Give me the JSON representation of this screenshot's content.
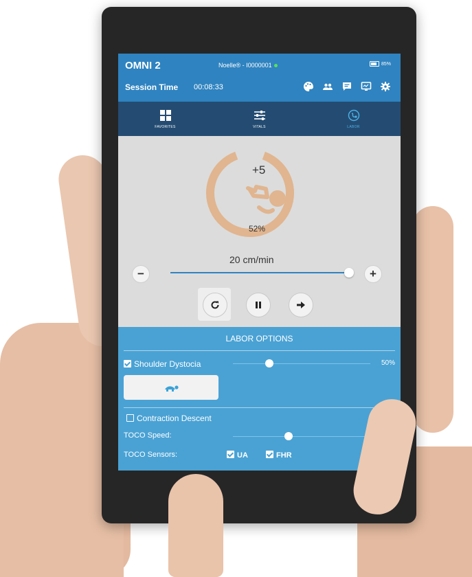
{
  "header": {
    "app_title": "OMNI 2",
    "patient": "Noelle® - I0000001",
    "battery": "85%",
    "session_label": "Session Time",
    "session_time": "00:08:33",
    "tool_icons": [
      "palette-icon",
      "people-icon",
      "chat-icon",
      "monitor-icon",
      "gear-icon"
    ]
  },
  "nav": {
    "tabs": [
      {
        "label": "FAVORITES",
        "icon": "grid-icon"
      },
      {
        "label": "VITALS",
        "icon": "sliders-icon"
      },
      {
        "label": "LABOR",
        "icon": "labor-icon",
        "active": true
      }
    ]
  },
  "labor": {
    "station": "+5",
    "progress_percent": "52%",
    "progress_value": 52,
    "speed": "20 cm/min",
    "speed_slider_fraction": 0.97
  },
  "options": {
    "title": "LABOR OPTIONS",
    "shoulder_dystocia": {
      "label": "Shoulder Dystocia",
      "checked": true,
      "value": "50%",
      "slider_fraction": 0.25
    },
    "contraction_descent": {
      "label": "Contraction Descent",
      "checked": false
    },
    "toco_speed": {
      "label": "TOCO Speed:",
      "slider_fraction": 0.38
    },
    "toco_sensors": {
      "label": "TOCO Sensors:",
      "ua": "UA",
      "fhr": "FHR"
    }
  },
  "colors": {
    "header_blue": "#2f83c0",
    "nav_navy": "#244c72",
    "options_blue": "#4aa2d4",
    "ring_tan": "#e0b58f"
  }
}
